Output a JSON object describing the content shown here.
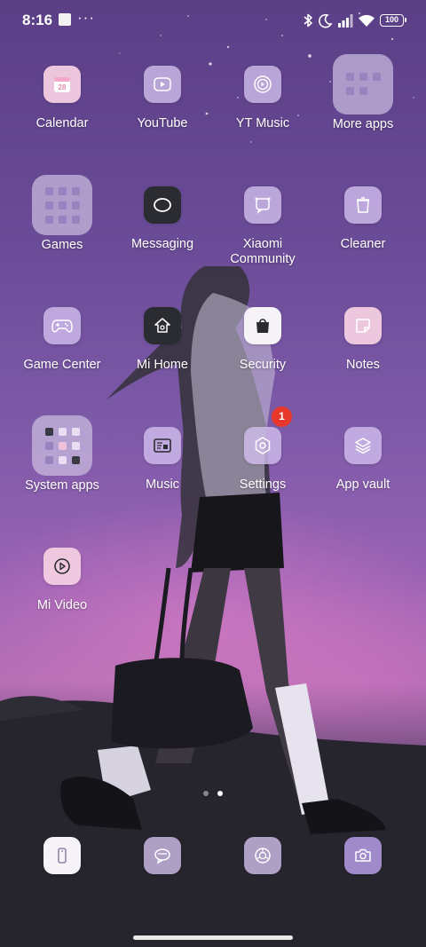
{
  "status_bar": {
    "time": "8:16",
    "more": "···",
    "battery": "100"
  },
  "apps": {
    "calendar": {
      "label": "Calendar",
      "icon_text": "28",
      "icon": "calendar-icon"
    },
    "youtube": {
      "label": "YouTube",
      "icon": "play-icon"
    },
    "yt_music": {
      "label": "YT Music",
      "icon": "music-disc-icon"
    },
    "more_apps": {
      "label": "More apps",
      "icon": "folder-icon"
    },
    "games": {
      "label": "Games",
      "icon": "folder-icon"
    },
    "messaging": {
      "label": "Messaging",
      "icon": "chat-bubble-icon"
    },
    "xiaomi_community": {
      "label": "Xiaomi Community",
      "icon": "community-icon"
    },
    "cleaner": {
      "label": "Cleaner",
      "icon": "trash-icon"
    },
    "game_center": {
      "label": "Game Center",
      "icon": "gamepad-icon"
    },
    "mi_home": {
      "label": "Mi Home",
      "icon": "home-icon"
    },
    "security": {
      "label": "Security",
      "icon": "shopping-bag-icon"
    },
    "notes": {
      "label": "Notes",
      "icon": "note-icon"
    },
    "system_apps": {
      "label": "System apps",
      "icon": "folder-icon"
    },
    "music": {
      "label": "Music",
      "icon": "music-icon"
    },
    "settings": {
      "label": "Settings",
      "icon": "gear-icon",
      "badge": "1"
    },
    "app_vault": {
      "label": "App vault",
      "icon": "layers-icon"
    },
    "mi_video": {
      "label": "Mi Video",
      "icon": "video-play-icon"
    }
  },
  "dock": [
    {
      "icon": "phone-icon"
    },
    {
      "icon": "chat-bubble-icon"
    },
    {
      "icon": "browser-icon"
    },
    {
      "icon": "camera-icon"
    }
  ],
  "page_indicator": {
    "pages": 2,
    "current": 2
  },
  "colors": {
    "badge": "#e8382c",
    "icon_tint": "#d1beec",
    "icon_pink": "#f3cde2"
  }
}
